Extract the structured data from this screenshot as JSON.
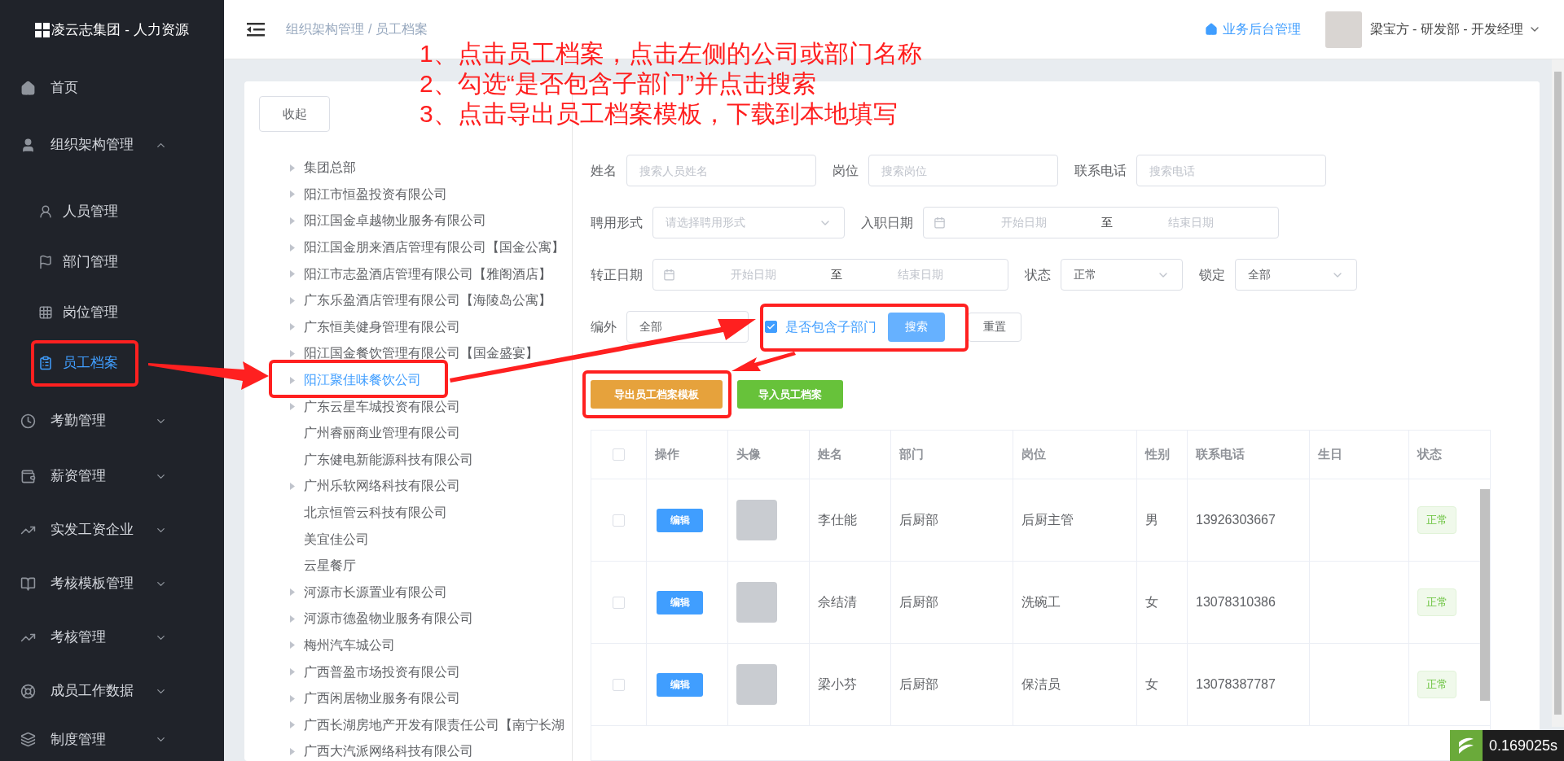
{
  "sidebar": {
    "title": "凌云志集团 - 人力资源",
    "items": [
      {
        "label": "首页",
        "kind": "link"
      },
      {
        "label": "组织架构管理",
        "kind": "group",
        "expanded": true,
        "children": [
          {
            "label": "人员管理",
            "selected": false
          },
          {
            "label": "部门管理",
            "selected": false
          },
          {
            "label": "岗位管理",
            "selected": false
          },
          {
            "label": "员工档案",
            "selected": true
          }
        ]
      },
      {
        "label": "考勤管理",
        "kind": "group",
        "expanded": false
      },
      {
        "label": "薪资管理",
        "kind": "group",
        "expanded": false
      },
      {
        "label": "实发工资企业",
        "kind": "group",
        "expanded": false
      },
      {
        "label": "考核模板管理",
        "kind": "group",
        "expanded": false
      },
      {
        "label": "考核管理",
        "kind": "group",
        "expanded": false
      },
      {
        "label": "成员工作数据",
        "kind": "group",
        "expanded": false
      },
      {
        "label": "制度管理",
        "kind": "group",
        "expanded": false
      }
    ]
  },
  "header": {
    "breadcrumb": [
      "组织架构管理",
      "员工档案"
    ],
    "separator": "/",
    "backend_link": "业务后台管理",
    "user": "梁宝方 - 研发部 - 开发经理"
  },
  "annotations": [
    "1、点击员工档案，点击左侧的公司或部门名称",
    "2、勾选“是否包含子部门”并点击搜索",
    "3、点击导出员工档案模板，下载到本地填写"
  ],
  "collapse_button": "收起",
  "tree": [
    {
      "label": "集团总部",
      "has_children": true,
      "selected": false
    },
    {
      "label": "阳江市恒盈投资有限公司",
      "has_children": true,
      "selected": false
    },
    {
      "label": "阳江国金卓越物业服务有限公司",
      "has_children": true,
      "selected": false
    },
    {
      "label": "阳江国金朋来酒店管理有限公司【国金公寓】",
      "has_children": true,
      "selected": false
    },
    {
      "label": "阳江市志盈酒店管理有限公司【雅阁酒店】",
      "has_children": true,
      "selected": false
    },
    {
      "label": "广东乐盈酒店管理有限公司【海陵岛公寓】",
      "has_children": true,
      "selected": false
    },
    {
      "label": "广东恒美健身管理有限公司",
      "has_children": true,
      "selected": false
    },
    {
      "label": "阳江国金餐饮管理有限公司【国金盛宴】",
      "has_children": true,
      "selected": false
    },
    {
      "label": "阳江聚佳味餐饮公司",
      "has_children": true,
      "selected": true
    },
    {
      "label": "广东云星车城投资有限公司",
      "has_children": true,
      "selected": false
    },
    {
      "label": "广州睿丽商业管理有限公司",
      "has_children": false,
      "selected": false
    },
    {
      "label": "广东健电新能源科技有限公司",
      "has_children": false,
      "selected": false
    },
    {
      "label": "广州乐软网络科技有限公司",
      "has_children": true,
      "selected": false
    },
    {
      "label": "北京恒管云科技有限公司",
      "has_children": false,
      "selected": false
    },
    {
      "label": "美宜佳公司",
      "has_children": false,
      "selected": false
    },
    {
      "label": "云星餐厅",
      "has_children": false,
      "selected": false
    },
    {
      "label": "河源市长源置业有限公司",
      "has_children": true,
      "selected": false
    },
    {
      "label": "河源市德盈物业服务有限公司",
      "has_children": true,
      "selected": false
    },
    {
      "label": "梅州汽车城公司",
      "has_children": true,
      "selected": false
    },
    {
      "label": "广西普盈市场投资有限公司",
      "has_children": true,
      "selected": false
    },
    {
      "label": "广西闲居物业服务有限公司",
      "has_children": true,
      "selected": false
    },
    {
      "label": "广西长湖房地产开发有限责任公司【南宁长湖",
      "has_children": true,
      "selected": false
    },
    {
      "label": "广西大汽派网络科技有限公司",
      "has_children": true,
      "selected": false
    }
  ],
  "filters": [
    [
      {
        "label": "姓名",
        "kind": "input",
        "placeholder": "搜索人员姓名"
      },
      {
        "label": "岗位",
        "kind": "input",
        "placeholder": "搜索岗位"
      },
      {
        "label": "联系电话",
        "kind": "input",
        "placeholder": "搜索电话"
      }
    ],
    [
      {
        "label": "聘用形式",
        "kind": "select",
        "placeholder": "请选择聘用形式"
      },
      {
        "label": "入职日期",
        "kind": "daterange",
        "start_placeholder": "开始日期",
        "separator": "至",
        "end_placeholder": "结束日期"
      }
    ],
    [
      {
        "label": "转正日期",
        "kind": "daterange",
        "start_placeholder": "开始日期",
        "separator": "至",
        "end_placeholder": "结束日期"
      },
      {
        "label": "状态",
        "kind": "select",
        "value": "正常"
      },
      {
        "label": "锁定",
        "kind": "select",
        "value": "全部"
      }
    ],
    [
      {
        "label": "编外",
        "kind": "select",
        "value": "全部"
      }
    ]
  ],
  "include_sub": {
    "label": "是否包含子部门",
    "checked": true
  },
  "search_button": "搜索",
  "reset_button": "重置",
  "actions": [
    {
      "label": "导出员工档案模板",
      "kind": "warning"
    },
    {
      "label": "导入员工档案",
      "kind": "success"
    }
  ],
  "table": {
    "select_all_checked": false,
    "columns": [
      "操作",
      "头像",
      "姓名",
      "部门",
      "岗位",
      "性别",
      "联系电话",
      "生日",
      "状态"
    ],
    "rows": [
      {
        "checked": false,
        "action": "编辑",
        "name": "李仕能",
        "department": "后厨部",
        "position": "后厨主管",
        "gender": "男",
        "phone": "13926303667",
        "status": "正常"
      },
      {
        "checked": false,
        "action": "编辑",
        "name": "佘结清",
        "department": "后厨部",
        "position": "洗碗工",
        "gender": "女",
        "phone": "13078310386",
        "status": "正常"
      },
      {
        "checked": false,
        "action": "编辑",
        "name": "梁小芬",
        "department": "后厨部",
        "position": "保洁员",
        "gender": "女",
        "phone": "13078387787",
        "status": "正常"
      }
    ]
  },
  "timer": "0.169025s"
}
